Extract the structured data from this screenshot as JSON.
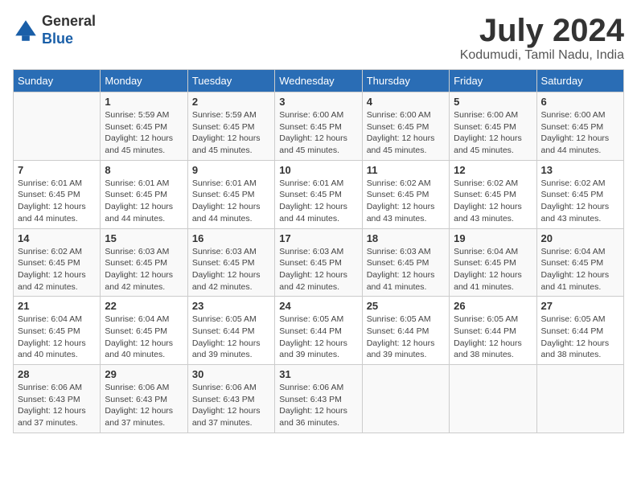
{
  "header": {
    "logo_general": "General",
    "logo_blue": "Blue",
    "month_title": "July 2024",
    "location": "Kodumudi, Tamil Nadu, India"
  },
  "days_of_week": [
    "Sunday",
    "Monday",
    "Tuesday",
    "Wednesday",
    "Thursday",
    "Friday",
    "Saturday"
  ],
  "weeks": [
    [
      {
        "day": "",
        "text": ""
      },
      {
        "day": "1",
        "text": "Sunrise: 5:59 AM\nSunset: 6:45 PM\nDaylight: 12 hours\nand 45 minutes."
      },
      {
        "day": "2",
        "text": "Sunrise: 5:59 AM\nSunset: 6:45 PM\nDaylight: 12 hours\nand 45 minutes."
      },
      {
        "day": "3",
        "text": "Sunrise: 6:00 AM\nSunset: 6:45 PM\nDaylight: 12 hours\nand 45 minutes."
      },
      {
        "day": "4",
        "text": "Sunrise: 6:00 AM\nSunset: 6:45 PM\nDaylight: 12 hours\nand 45 minutes."
      },
      {
        "day": "5",
        "text": "Sunrise: 6:00 AM\nSunset: 6:45 PM\nDaylight: 12 hours\nand 45 minutes."
      },
      {
        "day": "6",
        "text": "Sunrise: 6:00 AM\nSunset: 6:45 PM\nDaylight: 12 hours\nand 44 minutes."
      }
    ],
    [
      {
        "day": "7",
        "text": "Sunrise: 6:01 AM\nSunset: 6:45 PM\nDaylight: 12 hours\nand 44 minutes."
      },
      {
        "day": "8",
        "text": "Sunrise: 6:01 AM\nSunset: 6:45 PM\nDaylight: 12 hours\nand 44 minutes."
      },
      {
        "day": "9",
        "text": "Sunrise: 6:01 AM\nSunset: 6:45 PM\nDaylight: 12 hours\nand 44 minutes."
      },
      {
        "day": "10",
        "text": "Sunrise: 6:01 AM\nSunset: 6:45 PM\nDaylight: 12 hours\nand 44 minutes."
      },
      {
        "day": "11",
        "text": "Sunrise: 6:02 AM\nSunset: 6:45 PM\nDaylight: 12 hours\nand 43 minutes."
      },
      {
        "day": "12",
        "text": "Sunrise: 6:02 AM\nSunset: 6:45 PM\nDaylight: 12 hours\nand 43 minutes."
      },
      {
        "day": "13",
        "text": "Sunrise: 6:02 AM\nSunset: 6:45 PM\nDaylight: 12 hours\nand 43 minutes."
      }
    ],
    [
      {
        "day": "14",
        "text": "Sunrise: 6:02 AM\nSunset: 6:45 PM\nDaylight: 12 hours\nand 42 minutes."
      },
      {
        "day": "15",
        "text": "Sunrise: 6:03 AM\nSunset: 6:45 PM\nDaylight: 12 hours\nand 42 minutes."
      },
      {
        "day": "16",
        "text": "Sunrise: 6:03 AM\nSunset: 6:45 PM\nDaylight: 12 hours\nand 42 minutes."
      },
      {
        "day": "17",
        "text": "Sunrise: 6:03 AM\nSunset: 6:45 PM\nDaylight: 12 hours\nand 42 minutes."
      },
      {
        "day": "18",
        "text": "Sunrise: 6:03 AM\nSunset: 6:45 PM\nDaylight: 12 hours\nand 41 minutes."
      },
      {
        "day": "19",
        "text": "Sunrise: 6:04 AM\nSunset: 6:45 PM\nDaylight: 12 hours\nand 41 minutes."
      },
      {
        "day": "20",
        "text": "Sunrise: 6:04 AM\nSunset: 6:45 PM\nDaylight: 12 hours\nand 41 minutes."
      }
    ],
    [
      {
        "day": "21",
        "text": "Sunrise: 6:04 AM\nSunset: 6:45 PM\nDaylight: 12 hours\nand 40 minutes."
      },
      {
        "day": "22",
        "text": "Sunrise: 6:04 AM\nSunset: 6:45 PM\nDaylight: 12 hours\nand 40 minutes."
      },
      {
        "day": "23",
        "text": "Sunrise: 6:05 AM\nSunset: 6:44 PM\nDaylight: 12 hours\nand 39 minutes."
      },
      {
        "day": "24",
        "text": "Sunrise: 6:05 AM\nSunset: 6:44 PM\nDaylight: 12 hours\nand 39 minutes."
      },
      {
        "day": "25",
        "text": "Sunrise: 6:05 AM\nSunset: 6:44 PM\nDaylight: 12 hours\nand 39 minutes."
      },
      {
        "day": "26",
        "text": "Sunrise: 6:05 AM\nSunset: 6:44 PM\nDaylight: 12 hours\nand 38 minutes."
      },
      {
        "day": "27",
        "text": "Sunrise: 6:05 AM\nSunset: 6:44 PM\nDaylight: 12 hours\nand 38 minutes."
      }
    ],
    [
      {
        "day": "28",
        "text": "Sunrise: 6:06 AM\nSunset: 6:43 PM\nDaylight: 12 hours\nand 37 minutes."
      },
      {
        "day": "29",
        "text": "Sunrise: 6:06 AM\nSunset: 6:43 PM\nDaylight: 12 hours\nand 37 minutes."
      },
      {
        "day": "30",
        "text": "Sunrise: 6:06 AM\nSunset: 6:43 PM\nDaylight: 12 hours\nand 37 minutes."
      },
      {
        "day": "31",
        "text": "Sunrise: 6:06 AM\nSunset: 6:43 PM\nDaylight: 12 hours\nand 36 minutes."
      },
      {
        "day": "",
        "text": ""
      },
      {
        "day": "",
        "text": ""
      },
      {
        "day": "",
        "text": ""
      }
    ]
  ]
}
